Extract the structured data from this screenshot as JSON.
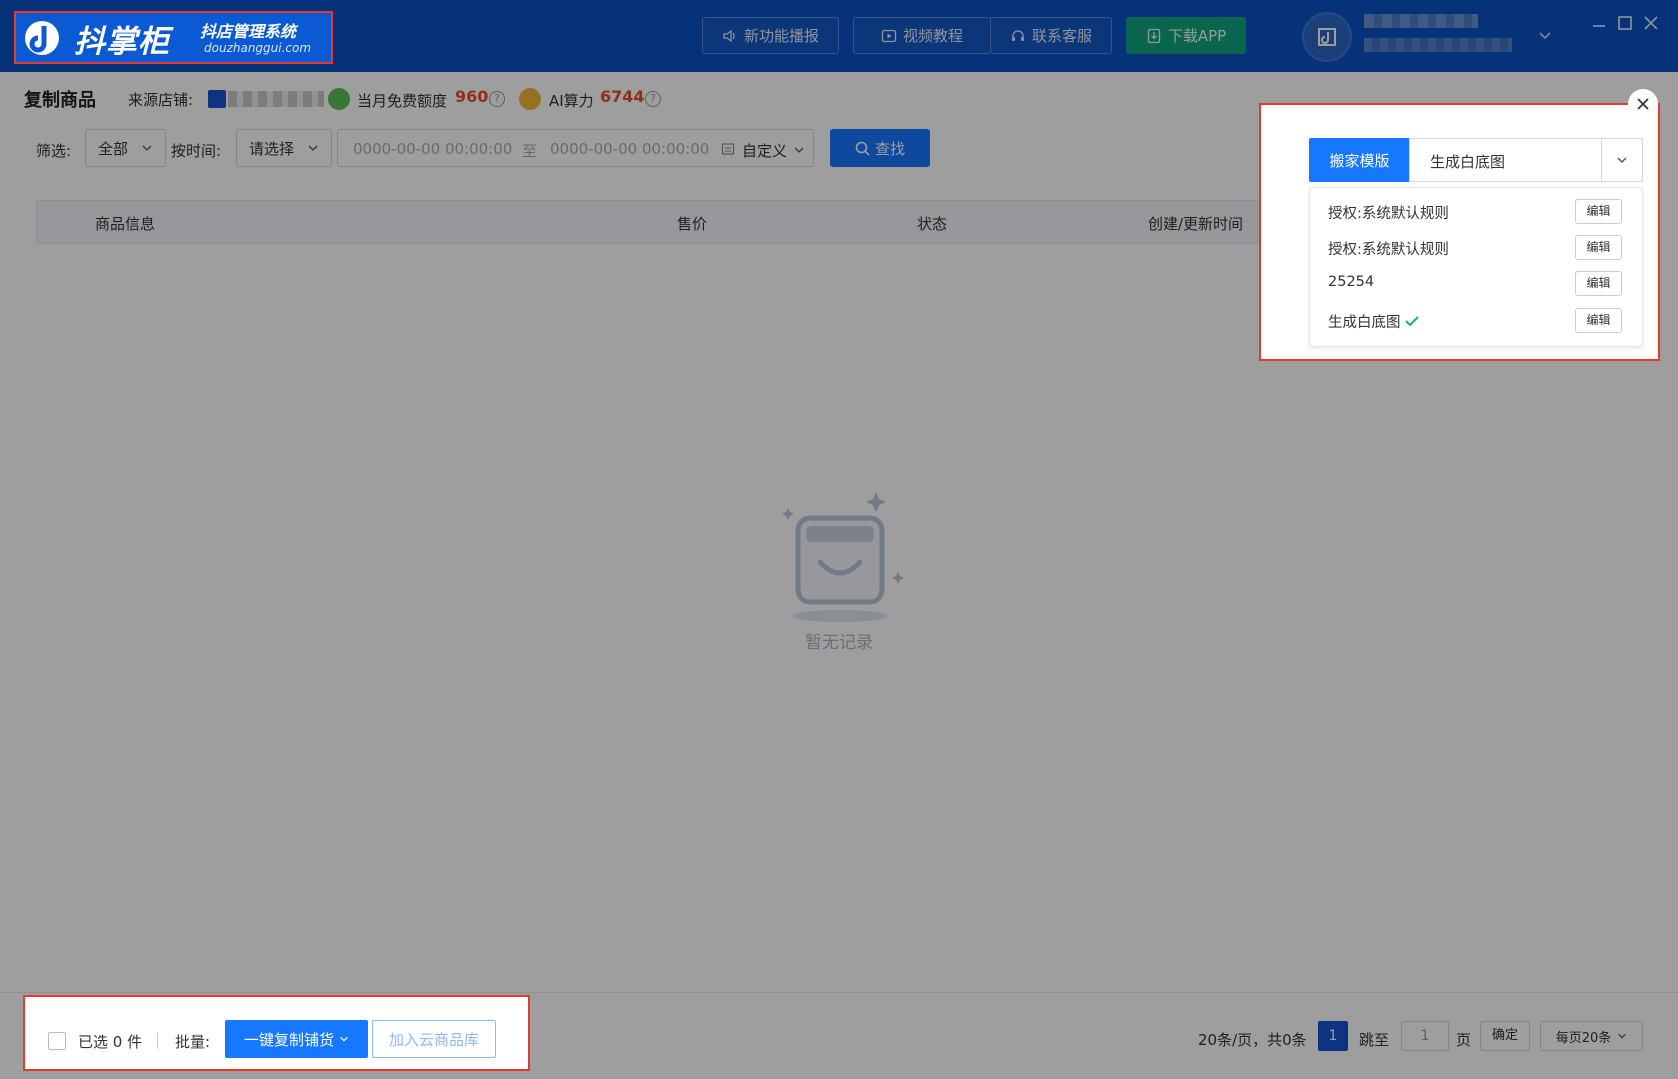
{
  "app": {
    "logo_main": "抖掌柜",
    "logo_tag": "抖店管理系统",
    "logo_url": "douzhanggui.com"
  },
  "topbar": {
    "news": "新功能播报",
    "video": "视频教程",
    "service": "联系客服",
    "download": "下载APP"
  },
  "header": {
    "title": "复制商品",
    "source_label": "来源店铺:",
    "quota_label": "当月免费额度",
    "quota_value": "960",
    "ai_label": "AI算力",
    "ai_value": "6744"
  },
  "filters": {
    "filter_label": "筛选:",
    "filter_value": "全部",
    "time_label": "按时间:",
    "time_value": "请选择",
    "date_start": "0000-00-00 00:00:00",
    "date_sep": "至",
    "date_end": "0000-00-00 00:00:00",
    "date_mode": "自定义",
    "search": "查找"
  },
  "table": {
    "columns": [
      "商品信息",
      "售价",
      "状态",
      "创建/更新时间"
    ]
  },
  "empty": {
    "text": "暂无记录"
  },
  "footer": {
    "selected": "已选 0 件",
    "bulk_label": "批量:",
    "copy_button": "一键复制铺货",
    "cloud_button": "加入云商品库",
    "page_info": "20条/页，共0条",
    "current_page": "1",
    "jump_label": "跳至",
    "jump_value": "1",
    "page_unit": "页",
    "confirm": "确定",
    "page_size": "每页20条"
  },
  "template": {
    "tag": "搬家模版",
    "selected": "生成白底图",
    "items": [
      {
        "name": "授权:系统默认规则",
        "edit": "编辑"
      },
      {
        "name": "授权:系统默认规则",
        "edit": "编辑"
      },
      {
        "name": "25254",
        "edit": "编辑"
      },
      {
        "name": "生成白底图",
        "edit": "编辑"
      }
    ]
  },
  "colors": {
    "brand": "#0a52c4",
    "primary": "#1677ff",
    "accent_value": "#e55226",
    "highlight": "#e43a2e",
    "success": "#10a37f"
  }
}
